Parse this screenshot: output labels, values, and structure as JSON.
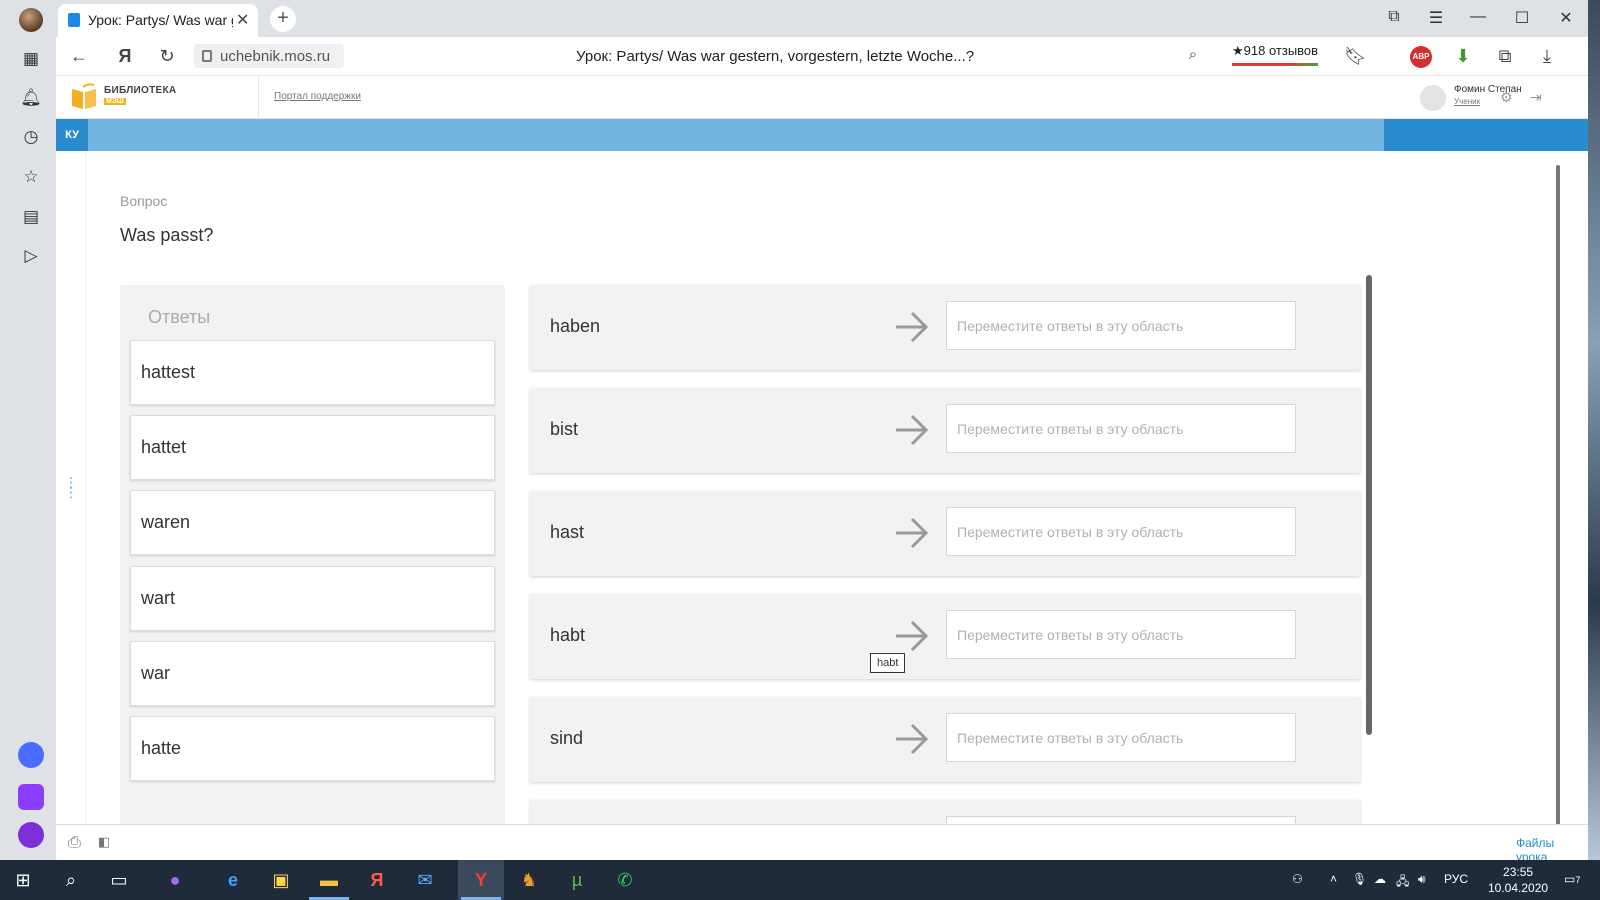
{
  "browser": {
    "tab_title": "Урок: Partys/ Was war g",
    "url": "uchebnik.mos.ru",
    "page_title": "Урок: Partys/ Was war gestern, vorgestern, letzte Woche...?",
    "reviews": "★918 отзывов",
    "abp_label": "ABP"
  },
  "site": {
    "logo_text": "БИБЛИОТЕКА",
    "logo_sub": "МЭШ",
    "support_link": "Портал поддержки",
    "user_name": "Фомин Степан",
    "user_role": "Ученик",
    "band_label": "КУ"
  },
  "question": {
    "label": "Вопрос",
    "text": "Was passt?"
  },
  "answers": {
    "title": "Ответы",
    "items": [
      "hattest",
      "hattet",
      "waren",
      "wart",
      "war",
      "hatte"
    ]
  },
  "pairs": {
    "placeholder": "Переместите ответы в эту область",
    "items": [
      "haben",
      "bist",
      "hast",
      "habt",
      "sind"
    ]
  },
  "tooltip": "habt",
  "bottom": {
    "files_link": "Файлы урока"
  },
  "taskbar": {
    "lang": "РУС",
    "time": "23:55",
    "date": "10.04.2020",
    "notifications": "7"
  }
}
